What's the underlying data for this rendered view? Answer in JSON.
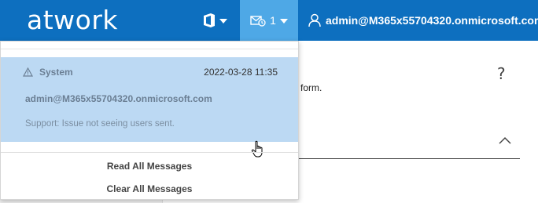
{
  "header": {
    "logo": "atwork",
    "office_icon": "office-icon",
    "messages": {
      "icon": "envelope-clock-icon",
      "count": "1"
    },
    "user": {
      "icon": "user-icon",
      "email": "admin@M365x55704320.onmicrosoft.com"
    }
  },
  "background": {
    "help_text": "?",
    "form_fragment": "form."
  },
  "dropdown": {
    "message": {
      "type_icon": "warning-icon",
      "type": "System",
      "date": "2022-03-28 11:35",
      "from": "admin@M365x55704320.onmicrosoft.com",
      "body": "Support: Issue not seeing users sent."
    },
    "read_all": "Read All Messages",
    "clear_all": "Clear All Messages"
  },
  "colors": {
    "header_bg": "#0d6fbf",
    "active_tab_bg": "#4ea8e6",
    "message_highlight": "#bcd9f3"
  }
}
